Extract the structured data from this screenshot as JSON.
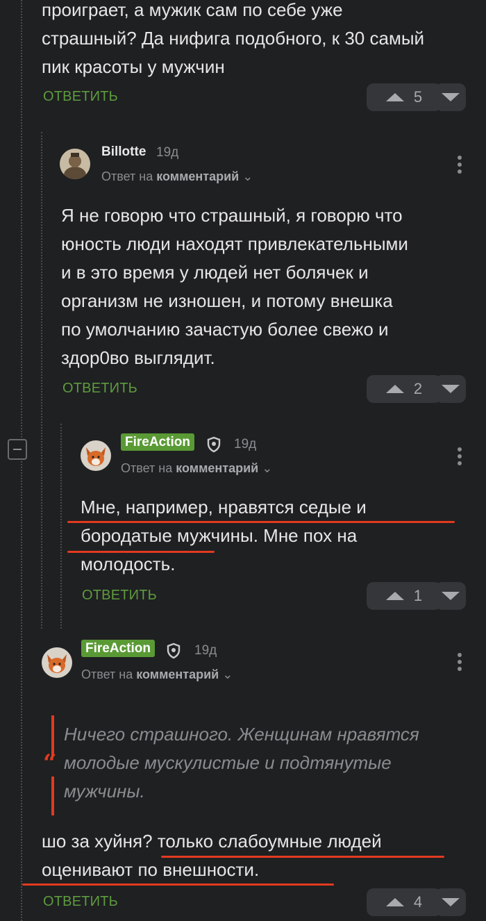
{
  "top": {
    "lines": [
      "проиграет, а мужик сам по себе уже",
      "страшный? Да нифига подобного, к 30 самый",
      "пик красоты у мужчин"
    ],
    "reply_label": "ОТВЕТИТЬ",
    "votes": "5"
  },
  "c1": {
    "user": "Billotte",
    "time": "19д",
    "meta_prefix": "Ответ на",
    "meta_link": "комментарий",
    "lines": [
      "Я не говорю что страшный, я говорю что",
      "юность люди находят привлекательными",
      "и в это время у людей нет болячек и",
      "организм не изношен, и потому внешка",
      "по умолчанию зачастую более свежо и",
      "здор0во выглядит."
    ],
    "reply_label": "ОТВЕТИТЬ",
    "votes": "2"
  },
  "c2": {
    "user": "FireAction",
    "time": "19д",
    "meta_prefix": "Ответ на",
    "meta_link": "комментарий",
    "lines": [
      "Мне, например, нравятся седые и",
      "бородатые мужчины. Мне пох на",
      "молодость."
    ],
    "reply_label": "ОТВЕТИТЬ",
    "votes": "1"
  },
  "c3": {
    "user": "FireAction",
    "time": "19д",
    "meta_prefix": "Ответ на",
    "meta_link": "комментарий",
    "quote_lines": [
      "Ничего страшного. Женщинам нравятся",
      "молодые мускулистые и подтянутые",
      "мужчины."
    ],
    "lines": [
      "шо за хуйня? только слабоумные людей",
      "оценивают по внешности."
    ],
    "reply_label": "ОТВЕТИТЬ",
    "votes": "4"
  },
  "colors": {
    "accent": "#5d9c3e",
    "highlight": "#e23a1f",
    "background": "#1f2022"
  }
}
